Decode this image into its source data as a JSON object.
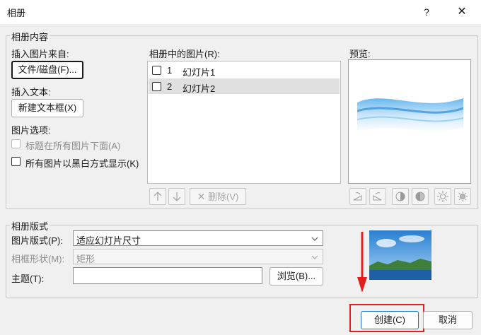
{
  "window": {
    "title": "相册",
    "help_glyph": "?",
    "close_glyph": "✕"
  },
  "content_group": {
    "legend": "相册内容",
    "insert_picture_from": "插入图片来自:",
    "file_disk_button": "文件/磁盘(F)...",
    "insert_text": "插入文本:",
    "new_textbox_button": "新建文本框(X)",
    "picture_options": "图片选项:",
    "caption_below": "标题在所有图片下面(A)",
    "all_black_white": "所有图片以黑白方式显示(K)"
  },
  "pictures_list": {
    "label": "相册中的图片(R):",
    "items": [
      {
        "index": "1",
        "name": "幻灯片1",
        "selected": false
      },
      {
        "index": "2",
        "name": "幻灯片2",
        "selected": true
      }
    ],
    "up_icon": "arrow-up-icon",
    "down_icon": "arrow-down-icon",
    "delete_label": "删除(V)"
  },
  "preview": {
    "label": "预览:",
    "tools": [
      "rotate-left-icon",
      "rotate-right-icon",
      "contrast-up-icon",
      "contrast-down-icon",
      "brightness-up-icon",
      "brightness-down-icon"
    ]
  },
  "layout_group": {
    "legend": "相册版式",
    "picture_layout_label": "图片版式(P):",
    "picture_layout_value": "适应幻灯片尺寸",
    "frame_shape_label": "相框形状(M):",
    "frame_shape_value": "矩形",
    "theme_label": "主题(T):",
    "theme_value": "",
    "browse_button": "浏览(B)..."
  },
  "footer": {
    "create_button": "创建(C)",
    "cancel_button": "取消"
  },
  "colors": {
    "annotation_red": "#e02020",
    "accent_blue": "#1e73c8"
  }
}
